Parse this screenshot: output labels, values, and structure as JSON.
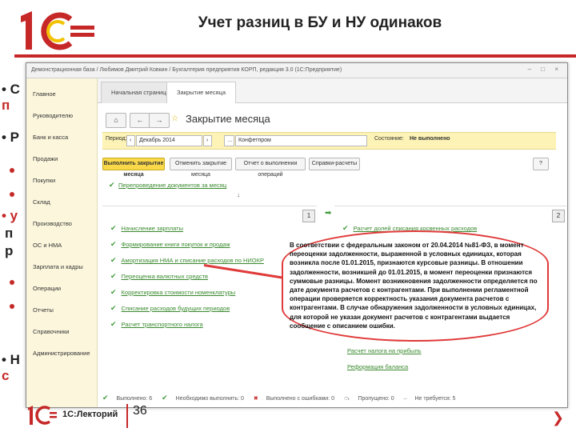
{
  "slide": {
    "title": "Учет разниц в БУ и НУ одинаков",
    "bullets": [
      {
        "text": "• С",
        "red": "п"
      },
      {
        "text": "• Р",
        "red": ""
      },
      {
        "text": "• у",
        "red": ""
      },
      {
        "text": "п",
        "red": ""
      },
      {
        "text": "р",
        "red": ""
      },
      {
        "text": "• Н",
        "red": "с"
      }
    ],
    "footer_brand": "1С:Лекторий",
    "page_number": "36",
    "accent_color": "#c62828"
  },
  "window": {
    "title": "Демонстрационная база / Любимов Дмитрий Ковкин / Бухгалтерия предприятия КОРП, редакция 3.0  (1С:Предприятие)",
    "controls": "– □ ×",
    "tabs": [
      "Начальная страница",
      "Закрытие месяца"
    ],
    "sidebar": [
      "Главное",
      "Руководителю",
      "Банк и касса",
      "Продажи",
      "Покупки",
      "Склад",
      "Производство",
      "ОС и НМА",
      "Зарплата и кадры",
      "Операции",
      "Отчеты",
      "Справочники",
      "Администрирование"
    ],
    "form_title": "Закрытие месяца",
    "filter": {
      "period_label": "Период:",
      "period_value": "Декабрь 2014",
      "org_value": "Конфетпром",
      "status_label": "Состояние:",
      "status_value": "Не выполнено"
    },
    "buttons": [
      "Выполнить закрытие месяца",
      "Отменить закрытие месяца",
      "Отчет о выполнении операций",
      "Справки-расчеты",
      "?"
    ],
    "reposting": "Перепроведение документов за месяц",
    "panel1_number": "1",
    "panel2_number": "2",
    "panel1_rows": [
      "Начисление зарплаты",
      "Формирование книги покупок и продаж",
      "Амортизация НМА и списание расходов по НИОКР",
      "Переоценка валютных средств",
      "Корректировка стоимости номенклатуры",
      "Списание расходов будущих периодов",
      "Расчет транспортного налога"
    ],
    "panel2_rows": [
      "Расчет долей списания косвенных расходов",
      "Расчет налога на прибыль",
      "Реформация баланса"
    ],
    "legend": [
      "Выполнено: 6",
      "Необходимо выполнить: 0",
      "Выполнено с ошибками: 0",
      "Пропущено: 0",
      "Не требуется: 5"
    ]
  },
  "callout": {
    "text": "В соответствии с федеральным законом от 20.04.2014 №81-ФЗ, в момент переоценки задолженности, выраженной в условных единицах, которая возникла после 01.01.2015, признаются курсовые разницы. В отношении задолженности, возникшей до 01.01.2015, в момент переоценки признаются суммовые разницы. Момент возникновения задолженности определяется по дате документа расчетов с контрагентами. При выполнении регламентной операции проверяется корректность указания документа расчетов с контрагентами. В случае обнаружения задолженности в условных единицах, для которой не указан документ расчетов с контрагентами выдается сообщение с описанием ошибки."
  }
}
